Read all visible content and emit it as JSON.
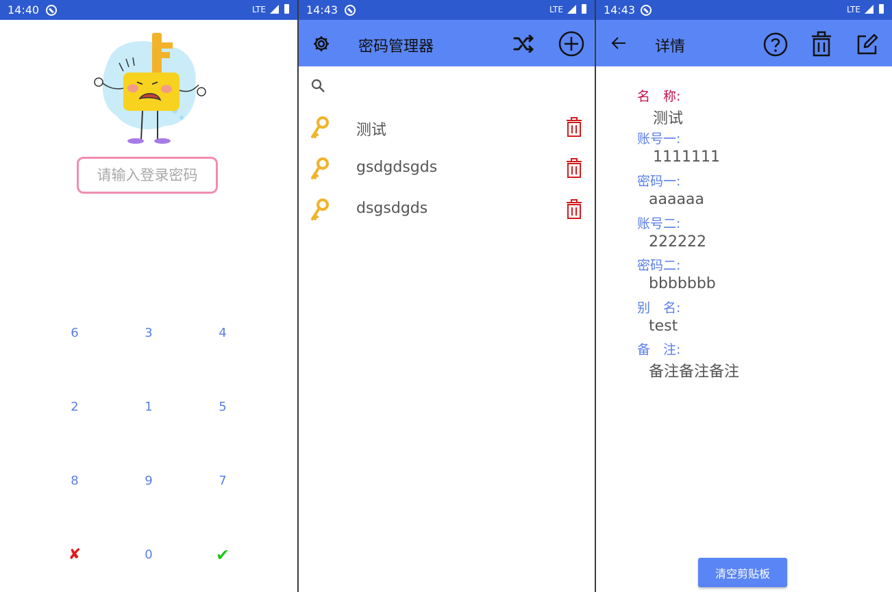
{
  "login_screen": {
    "status_time": "14:40",
    "status_network": "LTE",
    "password_placeholder": "请输入登录密码",
    "keypad": [
      "6",
      "3",
      "4",
      "2",
      "1",
      "5",
      "8",
      "9",
      "7",
      "✘",
      "0",
      "✔"
    ]
  },
  "list_screen": {
    "status_time": "14:43",
    "status_network": "LTE",
    "title": "密码管理器",
    "items": [
      {
        "name": "测试"
      },
      {
        "name": "gsdgdsgds"
      },
      {
        "name": "dsgsdgds"
      }
    ]
  },
  "detail_screen": {
    "status_time": "14:43",
    "status_network": "LTE",
    "title": "详情",
    "fields": [
      {
        "label": "名　称:",
        "value": "测试"
      },
      {
        "label": "账号一:",
        "value": "1111111"
      },
      {
        "label": "密码一:",
        "value": "aaaaaa"
      },
      {
        "label": "账号二:",
        "value": "222222"
      },
      {
        "label": "密码二:",
        "value": "bbbbbbb"
      },
      {
        "label": "别　名:",
        "value": "test"
      },
      {
        "label": "备　注:",
        "value": "备注备注备注"
      }
    ],
    "clear_clipboard_label": "清空剪贴板"
  },
  "colors": {
    "status_bar": "#2e5ad0",
    "app_bar": "#5a85f4",
    "label_blue": "#5a7ee8",
    "label_red": "#c4114a",
    "delete_red": "#d11a1a",
    "key_gold": "#f2b32a"
  },
  "icons": {
    "settings": "gear-icon",
    "shuffle": "shuffle-icon",
    "add": "add-circle-icon",
    "back": "back-arrow-icon",
    "help": "help-icon",
    "delete": "trash-icon",
    "edit": "edit-icon",
    "search": "search-icon",
    "key": "key-icon"
  }
}
